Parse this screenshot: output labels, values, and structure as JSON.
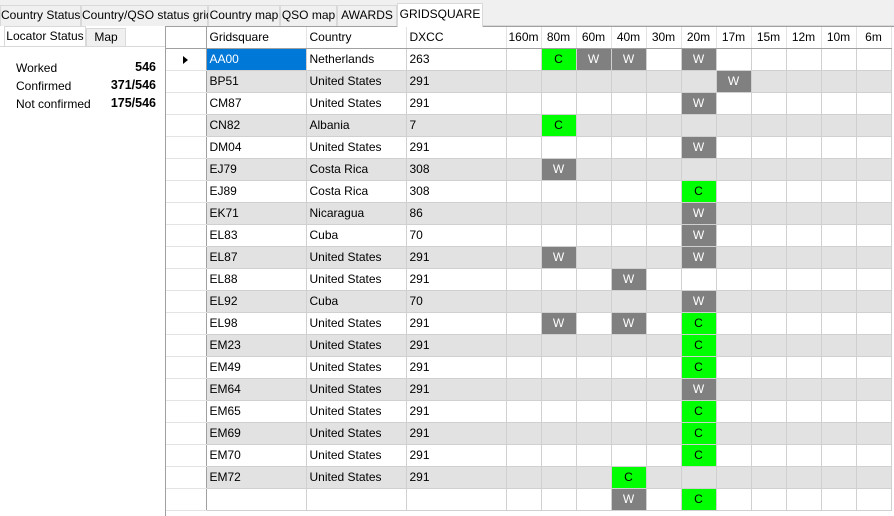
{
  "top_tabs": [
    {
      "label": "Country Status",
      "active": false
    },
    {
      "label": "Country/QSO status grid",
      "active": false
    },
    {
      "label": "Country map",
      "active": false
    },
    {
      "label": "QSO map",
      "active": false
    },
    {
      "label": "AWARDS",
      "active": false
    },
    {
      "label": "GRIDSQUARE",
      "active": true
    }
  ],
  "sub_tabs": [
    {
      "label": "Locator Status",
      "active": true
    },
    {
      "label": "Map",
      "active": false
    }
  ],
  "stats": {
    "worked_label": "Worked",
    "worked_value": "546",
    "confirmed_label": "Confirmed",
    "confirmed_value": "371/546",
    "not_confirmed_label": "Not confirmed",
    "not_confirmed_value": "175/546"
  },
  "grid": {
    "columns": {
      "gridsquare": "Gridsquare",
      "country": "Country",
      "dxcc": "DXCC"
    },
    "bands": [
      "160m",
      "80m",
      "60m",
      "40m",
      "30m",
      "20m",
      "17m",
      "15m",
      "12m",
      "10m",
      "6m"
    ],
    "colors": {
      "confirmed": "#00ff00",
      "worked": "#808080",
      "selected": "#0078d7"
    },
    "rows": [
      {
        "gridsquare": "AA00",
        "country": "Netherlands",
        "dxcc": "263",
        "bands": {
          "80m": "C",
          "60m": "W",
          "40m": "W",
          "20m": "W"
        }
      },
      {
        "gridsquare": "BP51",
        "country": "United States",
        "dxcc": "291",
        "bands": {
          "17m": "W"
        }
      },
      {
        "gridsquare": "CM87",
        "country": "United States",
        "dxcc": "291",
        "bands": {
          "20m": "W"
        }
      },
      {
        "gridsquare": "CN82",
        "country": "Albania",
        "dxcc": "7",
        "bands": {
          "80m": "C"
        }
      },
      {
        "gridsquare": "DM04",
        "country": "United States",
        "dxcc": "291",
        "bands": {
          "20m": "W"
        }
      },
      {
        "gridsquare": "EJ79",
        "country": "Costa Rica",
        "dxcc": "308",
        "bands": {
          "80m": "W"
        }
      },
      {
        "gridsquare": "EJ89",
        "country": "Costa Rica",
        "dxcc": "308",
        "bands": {
          "20m": "C"
        }
      },
      {
        "gridsquare": "EK71",
        "country": "Nicaragua",
        "dxcc": "86",
        "bands": {
          "20m": "W"
        }
      },
      {
        "gridsquare": "EL83",
        "country": "Cuba",
        "dxcc": "70",
        "bands": {
          "20m": "W"
        }
      },
      {
        "gridsquare": "EL87",
        "country": "United States",
        "dxcc": "291",
        "bands": {
          "80m": "W",
          "20m": "W"
        }
      },
      {
        "gridsquare": "EL88",
        "country": "United States",
        "dxcc": "291",
        "bands": {
          "40m": "W"
        }
      },
      {
        "gridsquare": "EL92",
        "country": "Cuba",
        "dxcc": "70",
        "bands": {
          "20m": "W"
        }
      },
      {
        "gridsquare": "EL98",
        "country": "United States",
        "dxcc": "291",
        "bands": {
          "80m": "W",
          "40m": "W",
          "20m": "C"
        }
      },
      {
        "gridsquare": "EM23",
        "country": "United States",
        "dxcc": "291",
        "bands": {
          "20m": "C"
        }
      },
      {
        "gridsquare": "EM49",
        "country": "United States",
        "dxcc": "291",
        "bands": {
          "20m": "C"
        }
      },
      {
        "gridsquare": "EM64",
        "country": "United States",
        "dxcc": "291",
        "bands": {
          "20m": "W"
        }
      },
      {
        "gridsquare": "EM65",
        "country": "United States",
        "dxcc": "291",
        "bands": {
          "20m": "C"
        }
      },
      {
        "gridsquare": "EM69",
        "country": "United States",
        "dxcc": "291",
        "bands": {
          "20m": "C"
        }
      },
      {
        "gridsquare": "EM70",
        "country": "United States",
        "dxcc": "291",
        "bands": {
          "20m": "C"
        }
      },
      {
        "gridsquare": "EM72",
        "country": "United States",
        "dxcc": "291",
        "bands": {
          "40m": "C"
        }
      },
      {
        "gridsquare": "",
        "country": "",
        "dxcc": "",
        "bands": {
          "40m": "W",
          "20m": "C"
        }
      }
    ]
  }
}
